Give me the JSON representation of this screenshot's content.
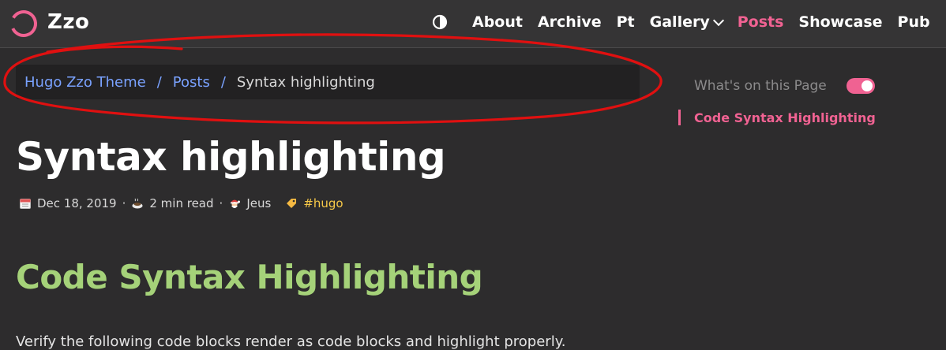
{
  "header": {
    "brand": "Zzo",
    "theme_toggle_icon": "contrast-icon",
    "nav": [
      {
        "label": "About",
        "active": false
      },
      {
        "label": "Archive",
        "active": false
      },
      {
        "label": "Pt",
        "active": false
      },
      {
        "label": "Gallery",
        "active": false,
        "has_dropdown": true
      },
      {
        "label": "Posts",
        "active": true
      },
      {
        "label": "Showcase",
        "active": false
      },
      {
        "label": "Pub",
        "active": false
      }
    ]
  },
  "breadcrumb": {
    "items": [
      "Hugo Zzo Theme",
      "Posts"
    ],
    "separator": "/",
    "current": "Syntax highlighting"
  },
  "toc": {
    "title": "What's on this Page",
    "toggle_on": true,
    "items": [
      "Code Syntax Highlighting"
    ]
  },
  "article": {
    "title": "Syntax highlighting",
    "date": "Dec 18, 2019",
    "date_icon": "calendar-icon",
    "read_time": "2 min read",
    "read_time_icon": "coffee-cup-icon",
    "author": "Jeus",
    "author_icon": "santa-face-icon",
    "tag": "#hugo",
    "tag_icon": "tag-icon",
    "meta_separator": "·",
    "section_heading": "Code Syntax Highlighting",
    "intro": "Verify the following code blocks render as code blocks and highlight properly."
  },
  "colors": {
    "accent": "#f06292",
    "link": "#7aa2ff",
    "heading_green": "#a5d279",
    "tag": "#f7c948",
    "background": "#2d2c2d",
    "annotation": "#e01010"
  }
}
